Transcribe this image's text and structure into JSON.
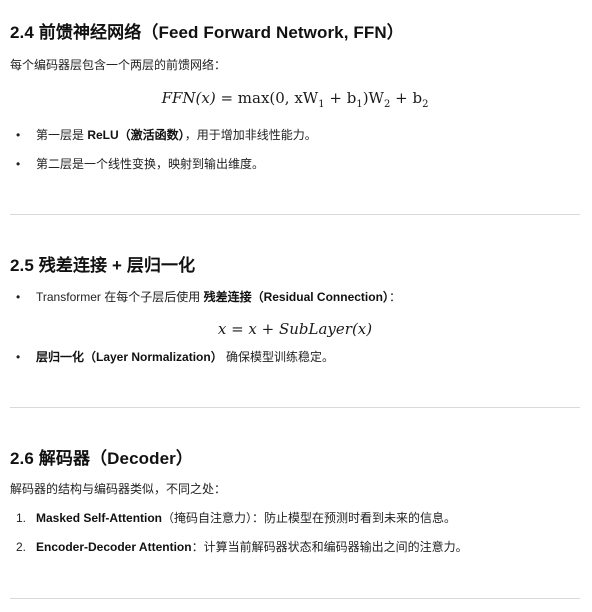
{
  "sec_ffn": {
    "heading": "2.4 前馈神经网络（Feed Forward Network, FFN）",
    "intro": "每个编码器层包含一个两层的前馈网络：",
    "formula": {
      "lhs": "FFN(x)",
      "rhs": "max(0, xW",
      "w1": "1",
      "mid": " + b",
      "b1": "1",
      "close": ")W",
      "w2": "2",
      "plus": " + b",
      "b2": "2"
    },
    "bullets": [
      {
        "prefix": "第一层是 ",
        "bold": "ReLU（激活函数）",
        "suffix": "，用于增加非线性能力。"
      },
      {
        "prefix": "第二层是一个线性变换，映射到输出维度。",
        "bold": "",
        "suffix": ""
      }
    ]
  },
  "sec_residual": {
    "heading": "2.5 残差连接 + 层归一化",
    "bullets": [
      {
        "prefix": "Transformer 在每个子层后使用 ",
        "bold": "残差连接（Residual Connection）",
        "suffix": "："
      },
      {
        "prefix": "",
        "bold": "层归一化（Layer Normalization）",
        "suffix": " 确保模型训练稳定。"
      }
    ],
    "formula": "x = x + SubLayer(x)"
  },
  "sec_decoder": {
    "heading": "2.6 解码器（Decoder）",
    "intro": "解码器的结构与编码器类似，不同之处：",
    "items": [
      {
        "num": "1.",
        "bold": "Masked Self-Attention",
        "suffix": "（掩码自注意力）：防止模型在预测时看到未来的信息。"
      },
      {
        "num": "2.",
        "bold": "Encoder-Decoder Attention",
        "suffix": "：计算当前解码器状态和编码器输出之间的注意力。"
      }
    ]
  }
}
